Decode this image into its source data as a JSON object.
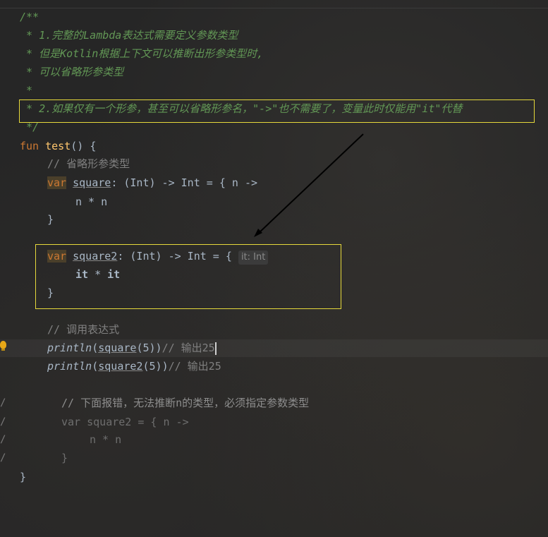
{
  "editor": {
    "doc_comment": [
      "/**",
      " * 1.完整的Lambda表达式需要定义参数类型",
      " * 但是Kotlin根据上下文可以推断出形参类型时,",
      " * 可以省略形参类型",
      " *",
      " * 2.如果仅有一个形参，甚至可以省略形参名，\"->\"也不需要了，变量此时仅能用\"it\"代替",
      " */"
    ],
    "fun_keyword": "fun",
    "fun_name": "test",
    "fun_sig_rest": "() {",
    "comment_omit": "// 省略形参类型",
    "var_keyword": "var",
    "square_name": "square",
    "square_type": ": (Int) -> Int = { n ->",
    "square_body": "n * n",
    "close_brace": "}",
    "square2_name": "square2",
    "square2_type": ": (Int) -> Int = {",
    "param_hint": "it: Int",
    "it_word": "it",
    "it_mul": " * ",
    "comment_call": "// 调用表达式",
    "println_label": "println",
    "call1_paren_open": "(",
    "call1_arg": "square",
    "call1_num": "(5)",
    "call1_close": ")",
    "call1_comment": "// 输出25",
    "call2_arg": "square2",
    "call2_comment": "// 输出25",
    "err_comment": "// 下面报错，无法推断n的类型，必须指定参数类型",
    "err_var": "var square2 = { n ->",
    "err_body": "n * n",
    "err_close": "}",
    "fun_close": "}",
    "gutter_slash": "/"
  },
  "colors": {
    "highlight_box": "#e6d93b",
    "keyword": "#cc7832",
    "doc_comment": "#629755",
    "number": "#6897bb",
    "bulb": "#e8a817"
  }
}
